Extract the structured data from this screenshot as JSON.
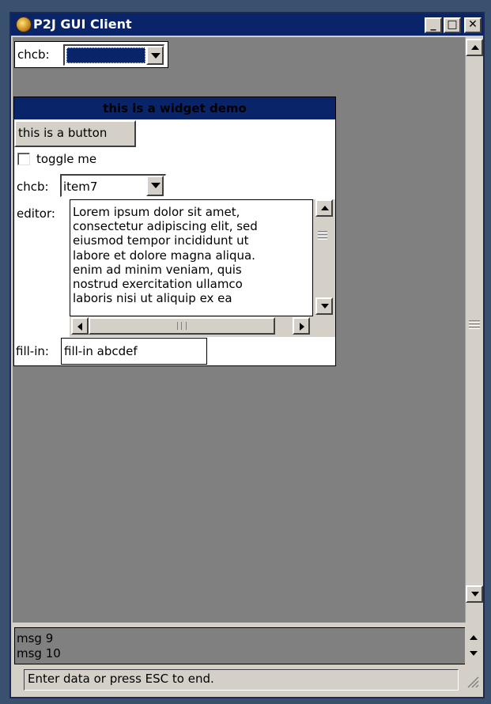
{
  "window": {
    "title": "P2J GUI Client",
    "buttons": {
      "minimize": "_",
      "maximize": "□",
      "close": "✕"
    }
  },
  "top_combo": {
    "label": "chcb:",
    "value": ""
  },
  "widget_frame": {
    "title": "this is a widget demo",
    "button_label": "this is a button",
    "toggle": {
      "label": "toggle me",
      "checked": false
    },
    "combo": {
      "label": "chcb:",
      "value": "item7"
    },
    "editor": {
      "label": "editor:",
      "lines": [
        "Lorem ipsum dolor sit amet,",
        "consectetur adipiscing elit, sed",
        "eiusmod tempor incididunt ut",
        "labore et dolore magna aliqua.",
        "enim ad minim veniam, quis",
        "nostrud exercitation ullamco",
        "laboris nisi ut aliquip ex ea"
      ]
    },
    "fillin": {
      "label": "fill-in:",
      "value": "fill-in abcdef"
    }
  },
  "messages": [
    "msg 9",
    "msg 10"
  ],
  "status": {
    "text": "Enter data or press ESC to end."
  },
  "colors": {
    "title_bar": "#0a246a",
    "viewport": "#808080",
    "chrome": "#d4d0c8",
    "desktop": "#39506f"
  }
}
